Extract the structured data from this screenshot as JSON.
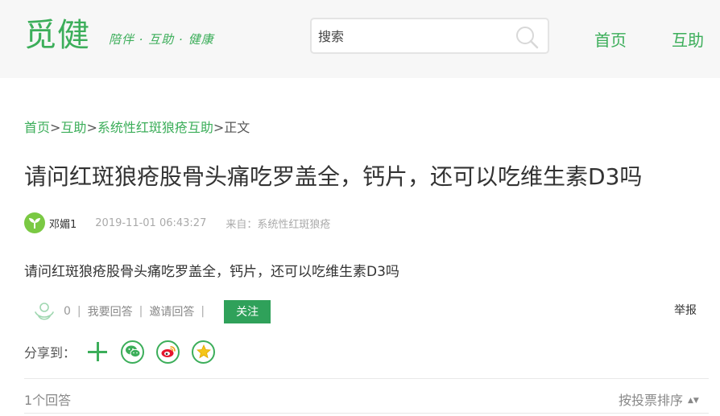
{
  "header": {
    "logo": "觅健",
    "slogan": "陪伴 · 互助 · 健康",
    "search_placeholder": "搜索",
    "nav": {
      "home": "首页",
      "help": "互助"
    }
  },
  "breadcrumb": {
    "home": "首页",
    "help": "互助",
    "group": "系统性红斑狼疮互助",
    "sep": ">",
    "current": "正文"
  },
  "question": {
    "title": "请问红斑狼疮股骨头痛吃罗盖全，钙片，还可以吃维生素D3吗",
    "author": "邓媚1",
    "time": "2019-11-01 06:43:27",
    "from_label": "来自：",
    "from_value": "系统性红斑狼疮",
    "body": "请问红斑狼疮股骨头痛吃罗盖全，钙片，还可以吃维生素D3吗"
  },
  "actions": {
    "like_count": "0",
    "divider": "|",
    "answer": "我要回答",
    "invite": "邀请回答",
    "follow": "关注",
    "report": "举报"
  },
  "share": {
    "label": "分享到："
  },
  "answers": {
    "count_text": "1个回答",
    "sort_label": "按投票排序",
    "sort_arrows": "▲▼"
  },
  "colors": {
    "brand": "#3cae5a",
    "follow_button": "#2fa15a"
  }
}
